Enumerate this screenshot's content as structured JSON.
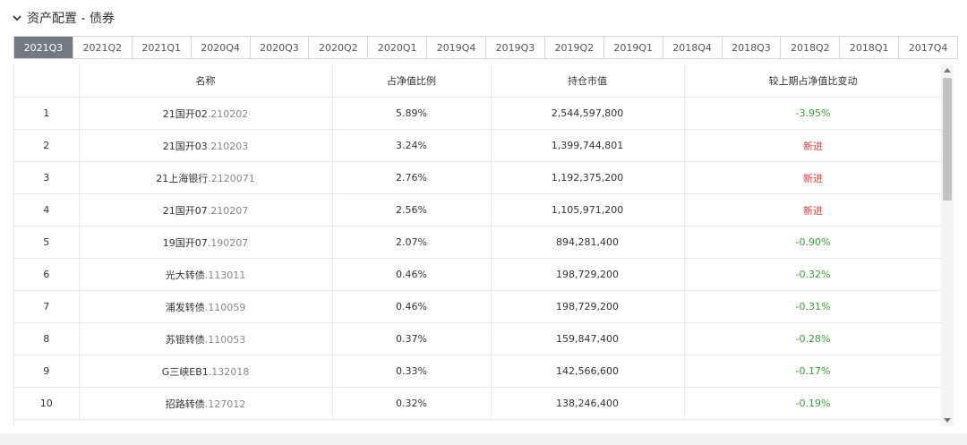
{
  "section": {
    "title": "资产配置 - 债券",
    "collapse_icon": "chevron-down-icon"
  },
  "tabs": [
    {
      "label": "2021Q3",
      "active": true
    },
    {
      "label": "2021Q2",
      "active": false
    },
    {
      "label": "2021Q1",
      "active": false
    },
    {
      "label": "2020Q4",
      "active": false
    },
    {
      "label": "2020Q3",
      "active": false
    },
    {
      "label": "2020Q2",
      "active": false
    },
    {
      "label": "2020Q1",
      "active": false
    },
    {
      "label": "2019Q4",
      "active": false
    },
    {
      "label": "2019Q3",
      "active": false
    },
    {
      "label": "2019Q2",
      "active": false
    },
    {
      "label": "2019Q1",
      "active": false
    },
    {
      "label": "2018Q4",
      "active": false
    },
    {
      "label": "2018Q3",
      "active": false
    },
    {
      "label": "2018Q2",
      "active": false
    },
    {
      "label": "2018Q1",
      "active": false
    },
    {
      "label": "2017Q4",
      "active": false
    }
  ],
  "table": {
    "headers": {
      "rank": "",
      "name": "名称",
      "ratio": "占净值比例",
      "value": "持仓市值",
      "change": "较上期占净值比变动"
    },
    "rows": [
      {
        "rank": "1",
        "name": "21国开02",
        "code": ".210202",
        "ratio": "5.89%",
        "value": "2,544,597,800",
        "change": "-3.95%",
        "change_type": "green"
      },
      {
        "rank": "2",
        "name": "21国开03",
        "code": ".210203",
        "ratio": "3.24%",
        "value": "1,399,744,801",
        "change": "新进",
        "change_type": "red"
      },
      {
        "rank": "3",
        "name": "21上海银行",
        "code": ".2120071",
        "ratio": "2.76%",
        "value": "1,192,375,200",
        "change": "新进",
        "change_type": "red"
      },
      {
        "rank": "4",
        "name": "21国开07",
        "code": ".210207",
        "ratio": "2.56%",
        "value": "1,105,971,200",
        "change": "新进",
        "change_type": "red"
      },
      {
        "rank": "5",
        "name": "19国开07",
        "code": ".190207",
        "ratio": "2.07%",
        "value": "894,281,400",
        "change": "-0.90%",
        "change_type": "green"
      },
      {
        "rank": "6",
        "name": "光大转债",
        "code": ".113011",
        "ratio": "0.46%",
        "value": "198,729,200",
        "change": "-0.32%",
        "change_type": "green"
      },
      {
        "rank": "7",
        "name": "浦发转债",
        "code": ".110059",
        "ratio": "0.46%",
        "value": "198,729,200",
        "change": "-0.31%",
        "change_type": "green"
      },
      {
        "rank": "8",
        "name": "苏银转债",
        "code": ".110053",
        "ratio": "0.37%",
        "value": "159,847,400",
        "change": "-0.28%",
        "change_type": "green"
      },
      {
        "rank": "9",
        "name": "G三峡EB1",
        "code": ".132018",
        "ratio": "0.33%",
        "value": "142,566,600",
        "change": "-0.17%",
        "change_type": "green"
      },
      {
        "rank": "10",
        "name": "招路转债",
        "code": ".127012",
        "ratio": "0.32%",
        "value": "138,246,400",
        "change": "-0.19%",
        "change_type": "green"
      }
    ]
  },
  "colors": {
    "active_tab_bg": "#6f7a83",
    "decrease": "#3a9b3a",
    "new_entry": "#e03a3a"
  }
}
